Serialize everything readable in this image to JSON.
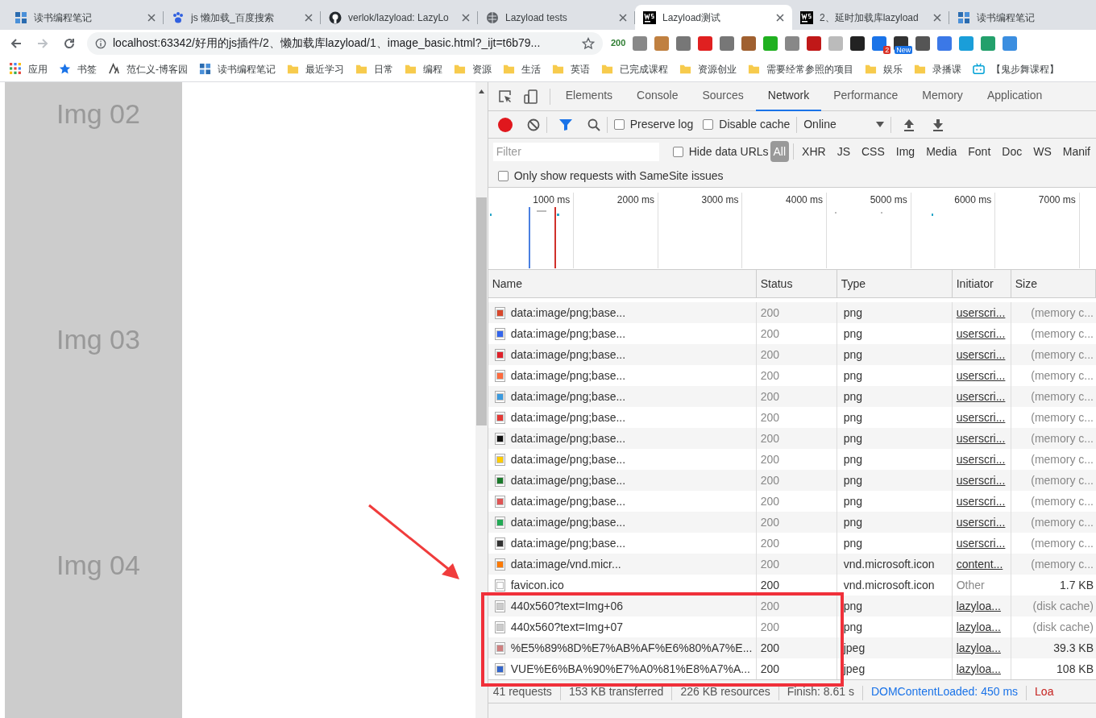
{
  "tabs": [
    {
      "title": "读书编程笔记",
      "selected": false
    },
    {
      "title": "js 懒加载_百度搜索",
      "selected": false
    },
    {
      "title": "verlok/lazyload: LazyLo",
      "selected": false
    },
    {
      "title": "Lazyload tests",
      "selected": false
    },
    {
      "title": "Lazyload测试",
      "selected": true
    },
    {
      "title": "2、延时加载库lazyload",
      "selected": false
    },
    {
      "title": "读书编程笔记",
      "selected": false
    }
  ],
  "address": "localhost:63342/好用的js插件/2、懒加载库lazyload/1、image_basic.html?_ijt=t6b79...",
  "extensions": [
    {
      "kind": "text",
      "text": "200"
    },
    {
      "kind": "icon"
    },
    {
      "kind": "icon"
    },
    {
      "kind": "icon"
    },
    {
      "kind": "icon"
    },
    {
      "kind": "icon"
    },
    {
      "kind": "icon"
    },
    {
      "kind": "icon"
    },
    {
      "kind": "icon"
    },
    {
      "kind": "icon"
    },
    {
      "kind": "icon"
    },
    {
      "kind": "icon"
    },
    {
      "kind": "icon",
      "badge": "2"
    },
    {
      "kind": "icon",
      "badge": "New"
    },
    {
      "kind": "icon"
    },
    {
      "kind": "icon"
    },
    {
      "kind": "icon"
    },
    {
      "kind": "icon"
    },
    {
      "kind": "icon"
    }
  ],
  "bookmarks": [
    {
      "kind": "apps",
      "label": "应用"
    },
    {
      "kind": "star",
      "label": "书签"
    },
    {
      "kind": "site",
      "label": "范仁义-博客园"
    },
    {
      "kind": "notebook",
      "label": "读书编程笔记"
    },
    {
      "kind": "folder",
      "label": "最近学习"
    },
    {
      "kind": "folder",
      "label": "日常"
    },
    {
      "kind": "folder",
      "label": "编程"
    },
    {
      "kind": "folder",
      "label": "资源"
    },
    {
      "kind": "folder",
      "label": "生活"
    },
    {
      "kind": "folder",
      "label": "英语"
    },
    {
      "kind": "folder",
      "label": "已完成课程"
    },
    {
      "kind": "folder",
      "label": "资源创业"
    },
    {
      "kind": "folder",
      "label": "需要经常参照的项目"
    },
    {
      "kind": "folder",
      "label": "娱乐"
    },
    {
      "kind": "folder",
      "label": "录播课"
    },
    {
      "kind": "tv",
      "label": "【鬼步舞课程】"
    }
  ],
  "page": {
    "placeholders": [
      "Img 02",
      "Img 03",
      "Img 04"
    ]
  },
  "devtools": {
    "panels": [
      {
        "label": "Elements",
        "selected": false
      },
      {
        "label": "Console",
        "selected": false
      },
      {
        "label": "Sources",
        "selected": false
      },
      {
        "label": "Network",
        "selected": true
      },
      {
        "label": "Performance",
        "selected": false
      },
      {
        "label": "Memory",
        "selected": false
      },
      {
        "label": "Application",
        "selected": false
      }
    ],
    "recording": true,
    "filter_active": true,
    "preserve_log": {
      "label": "Preserve log",
      "checked": false
    },
    "disable_cache": {
      "label": "Disable cache",
      "checked": false
    },
    "throttling": "Online",
    "filter": {
      "placeholder": "Filter"
    },
    "hide_data_urls": {
      "label": "Hide data URLs",
      "checked": false
    },
    "type_filters": [
      {
        "label": "All",
        "selected": true
      },
      {
        "label": "XHR",
        "selected": false
      },
      {
        "label": "JS",
        "selected": false
      },
      {
        "label": "CSS",
        "selected": false
      },
      {
        "label": "Img",
        "selected": false
      },
      {
        "label": "Media",
        "selected": false
      },
      {
        "label": "Font",
        "selected": false
      },
      {
        "label": "Doc",
        "selected": false
      },
      {
        "label": "WS",
        "selected": false
      },
      {
        "label": "Manif",
        "selected": false
      }
    ],
    "samesite": {
      "label": "Only show requests with SameSite issues",
      "checked": false
    },
    "timeline_ticks": [
      "1000 ms",
      "2000 ms",
      "3000 ms",
      "4000 ms",
      "5000 ms",
      "6000 ms",
      "7000 ms"
    ],
    "columns": [
      "Name",
      "Status",
      "Type",
      "Initiator",
      "Size"
    ],
    "rows": [
      {
        "name": "data:image/png;base...",
        "status": "200",
        "type": "png",
        "initiator": "userscri...",
        "initiator_link": true,
        "size": "(memory c...",
        "cached": true,
        "color": "#d9472b"
      },
      {
        "name": "data:image/png;base...",
        "status": "200",
        "type": "png",
        "initiator": "userscri...",
        "initiator_link": true,
        "size": "(memory c...",
        "cached": true,
        "color": "#3366ee"
      },
      {
        "name": "data:image/png;base...",
        "status": "200",
        "type": "png",
        "initiator": "userscri...",
        "initiator_link": true,
        "size": "(memory c...",
        "cached": true,
        "color": "#e0202a"
      },
      {
        "name": "data:image/png;base...",
        "status": "200",
        "type": "png",
        "initiator": "userscri...",
        "initiator_link": true,
        "size": "(memory c...",
        "cached": true,
        "color": "#ff6a3d"
      },
      {
        "name": "data:image/png;base...",
        "status": "200",
        "type": "png",
        "initiator": "userscri...",
        "initiator_link": true,
        "size": "(memory c...",
        "cached": true,
        "color": "#3a9be0"
      },
      {
        "name": "data:image/png;base...",
        "status": "200",
        "type": "png",
        "initiator": "userscri...",
        "initiator_link": true,
        "size": "(memory c...",
        "cached": true,
        "color": "#e53935"
      },
      {
        "name": "data:image/png;base...",
        "status": "200",
        "type": "png",
        "initiator": "userscri...",
        "initiator_link": true,
        "size": "(memory c...",
        "cached": true,
        "color": "#111111"
      },
      {
        "name": "data:image/png;base...",
        "status": "200",
        "type": "png",
        "initiator": "userscri...",
        "initiator_link": true,
        "size": "(memory c...",
        "cached": true,
        "color": "#ffcc00"
      },
      {
        "name": "data:image/png;base...",
        "status": "200",
        "type": "png",
        "initiator": "userscri...",
        "initiator_link": true,
        "size": "(memory c...",
        "cached": true,
        "color": "#1b7a2b"
      },
      {
        "name": "data:image/png;base...",
        "status": "200",
        "type": "png",
        "initiator": "userscri...",
        "initiator_link": true,
        "size": "(memory c...",
        "cached": true,
        "color": "#e05555"
      },
      {
        "name": "data:image/png;base...",
        "status": "200",
        "type": "png",
        "initiator": "userscri...",
        "initiator_link": true,
        "size": "(memory c...",
        "cached": true,
        "color": "#22aa55"
      },
      {
        "name": "data:image/png;base...",
        "status": "200",
        "type": "png",
        "initiator": "userscri...",
        "initiator_link": true,
        "size": "(memory c...",
        "cached": true,
        "color": "#333333"
      },
      {
        "name": "data:image/vnd.micr...",
        "status": "200",
        "type": "vnd.microsoft.icon",
        "initiator": "content...",
        "initiator_link": true,
        "size": "(memory c...",
        "cached": true,
        "color": "#ff7a00"
      },
      {
        "name": "favicon.ico",
        "status": "200",
        "type": "vnd.microsoft.icon",
        "initiator": "Other",
        "initiator_link": false,
        "size": "1.7 KB",
        "cached": false,
        "color": "#ffffff"
      },
      {
        "name": "440x560?text=Img+06",
        "status": "200",
        "type": "png",
        "initiator": "lazyloa...",
        "initiator_link": true,
        "size": "(disk cache)",
        "cached": true,
        "color": "#cccccc"
      },
      {
        "name": "440x560?text=Img+07",
        "status": "200",
        "type": "png",
        "initiator": "lazyloa...",
        "initiator_link": true,
        "size": "(disk cache)",
        "cached": true,
        "color": "#cccccc"
      },
      {
        "name": "%E5%89%8D%E7%AB%AF%E6%80%A7%E...",
        "status": "200",
        "type": "jpeg",
        "initiator": "lazyloa...",
        "initiator_link": true,
        "size": "39.3 KB",
        "cached": false,
        "color": "#d08080"
      },
      {
        "name": "VUE%E6%BA%90%E7%A0%81%E8%A7%A...",
        "status": "200",
        "type": "jpeg",
        "initiator": "lazyloa...",
        "initiator_link": true,
        "size": "108 KB",
        "cached": false,
        "color": "#3366cc"
      }
    ],
    "summary": [
      {
        "kind": "plain",
        "text": "41 requests"
      },
      {
        "kind": "plain",
        "text": "153 KB transferred"
      },
      {
        "kind": "plain",
        "text": "226 KB resources"
      },
      {
        "kind": "plain",
        "text": "Finish: 8.61 s"
      },
      {
        "kind": "dom",
        "text": "DOMContentLoaded: 450 ms"
      },
      {
        "kind": "load",
        "text": "Loa"
      }
    ]
  }
}
